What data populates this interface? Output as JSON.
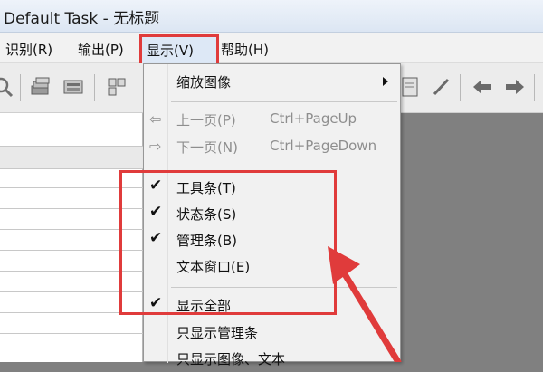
{
  "window": {
    "title": "Default Task - 无标题"
  },
  "menubar": {
    "items": [
      {
        "label": "识别(R)"
      },
      {
        "label": "输出(P)"
      },
      {
        "label": "显示(V)"
      },
      {
        "label": "帮助(H)"
      }
    ]
  },
  "dropdown": {
    "zoom": {
      "label": "缩放图像"
    },
    "prev": {
      "label": "上一页(P)",
      "shortcut": "Ctrl+PageUp"
    },
    "next": {
      "label": "下一页(N)",
      "shortcut": "Ctrl+PageDown"
    },
    "toolbar": {
      "label": "工具条(T)",
      "checked": true
    },
    "statusbar": {
      "label": "状态条(S)",
      "checked": true
    },
    "managebar": {
      "label": "管理条(B)",
      "checked": true
    },
    "textwindow": {
      "label": "文本窗口(E)",
      "checked": false
    },
    "showall": {
      "label": "显示全部",
      "checked": true
    },
    "showmanage": {
      "label": "只显示管理条"
    },
    "showimagetext": {
      "label": "只显示图像、文本"
    }
  },
  "colors": {
    "highlight_red": "#e03b3b",
    "menu_bg": "#f1f1f1",
    "workspace": "#808080"
  }
}
